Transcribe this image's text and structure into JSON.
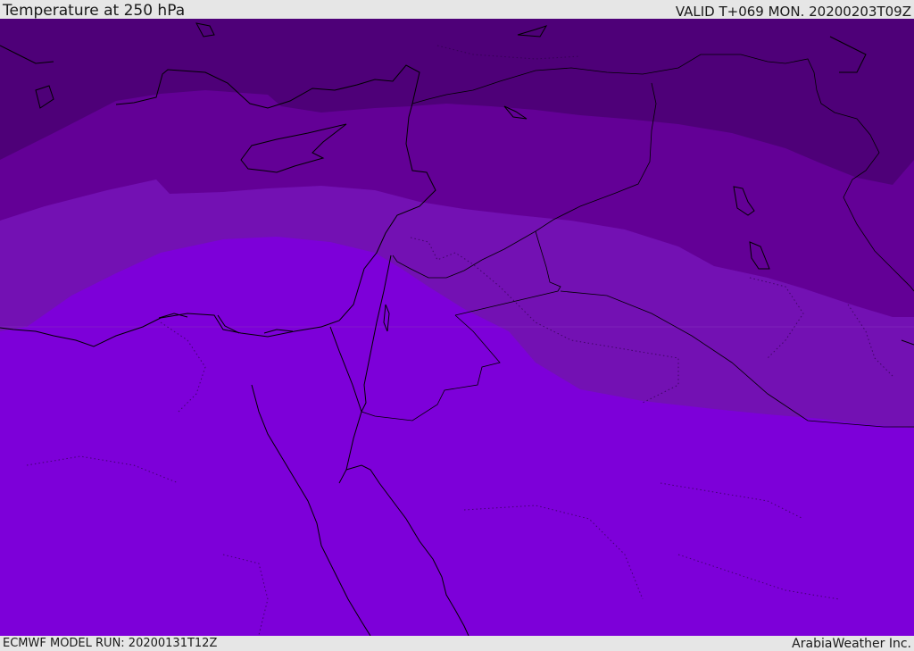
{
  "header": {
    "title": "Temperature at 250 hPa",
    "valid": "VALID T+069 MON. 20200203T09Z"
  },
  "footer": {
    "model_run": "ECMWF MODEL RUN: 20200131T12Z",
    "credit": "ArabiaWeather Inc."
  },
  "map": {
    "colors": {
      "band_coldest": "#4e0078",
      "band_cold": "#630096",
      "band_mid": "#7311b3",
      "band_warm": "#7d00d9",
      "coastline": "#000000",
      "border": "#000000"
    }
  }
}
